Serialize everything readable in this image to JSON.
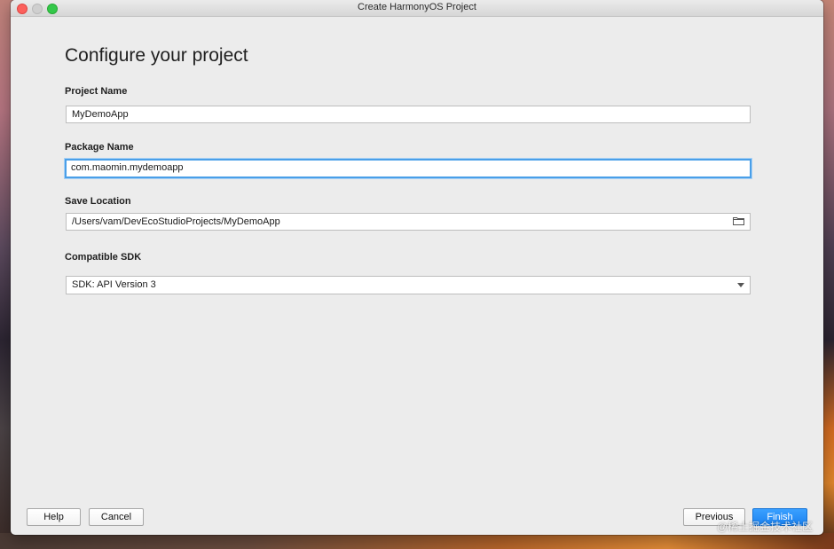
{
  "window": {
    "title": "Create HarmonyOS Project"
  },
  "page": {
    "heading": "Configure your project"
  },
  "form": {
    "project_name": {
      "label": "Project Name",
      "value": "MyDemoApp"
    },
    "package_name": {
      "label": "Package Name",
      "value": "com.maomin.mydemoapp"
    },
    "save_location": {
      "label": "Save Location",
      "value": "/Users/vam/DevEcoStudioProjects/MyDemoApp",
      "icon": "folder-icon"
    },
    "compatible_sdk": {
      "label": "Compatible SDK",
      "value": "SDK: API Version 3",
      "icon": "chevron-down-icon"
    }
  },
  "footer": {
    "help_label": "Help",
    "cancel_label": "Cancel",
    "previous_label": "Previous",
    "finish_label": "Finish"
  },
  "watermark": "@稀土掘金技术社区",
  "colors": {
    "accent": "#1b82f0",
    "focus_ring": "#4a9fe8",
    "window_bg": "#ececec"
  }
}
